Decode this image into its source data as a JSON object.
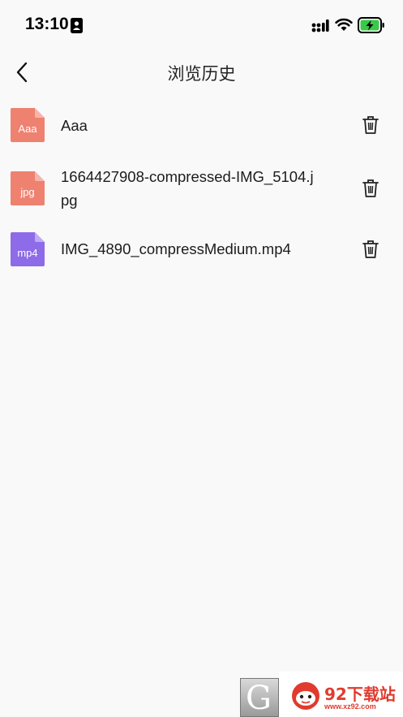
{
  "status_bar": {
    "time": "13:10",
    "icons": [
      "id-card-icon",
      "signal-icon",
      "wifi-icon",
      "battery-charging-icon"
    ],
    "battery_color": "#3ac84a"
  },
  "nav": {
    "back_icon": "chevron-left-icon",
    "title": "浏览历史"
  },
  "files": [
    {
      "badge": "Aaa",
      "name": "Aaa",
      "icon_color": "#ef8170",
      "icon_fold": "#f7b5aa"
    },
    {
      "badge": "jpg",
      "name": "1664427908-compressed-IMG_5104.jpg",
      "icon_color": "#ef8170",
      "icon_fold": "#f7b5aa"
    },
    {
      "badge": "mp4",
      "name": "IMG_4890_compressMedium.mp4",
      "icon_color": "#8e6be8",
      "icon_fold": "#c0aaf5"
    }
  ],
  "watermark": {
    "text": "92下载站",
    "url": "www.xz92.com",
    "color": "#e03b2e"
  }
}
